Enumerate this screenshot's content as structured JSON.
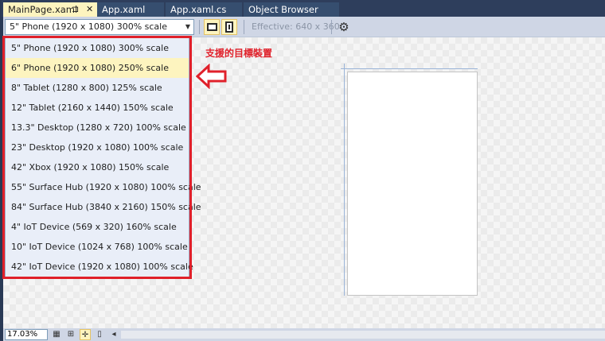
{
  "tabs": [
    {
      "label": "MainPage.xaml",
      "active": true,
      "pin": "⊐",
      "close": "✕"
    },
    {
      "label": "App.xaml",
      "active": false
    },
    {
      "label": "App.xaml.cs",
      "active": false
    },
    {
      "label": "Object Browser",
      "active": false
    }
  ],
  "toolbar": {
    "device_selected": "5\" Phone (1920 x 1080) 300% scale",
    "effective": "Effective: 640 x 360",
    "icons": [
      "landscape-icon",
      "portrait-icon",
      "gear-icon"
    ]
  },
  "device_list": {
    "items": [
      "5\" Phone (1920 x 1080) 300% scale",
      "6\" Phone (1920 x 1080) 250% scale",
      "8\" Tablet (1280 x 800) 125% scale",
      "12\" Tablet (2160 x 1440) 150% scale",
      "13.3\" Desktop (1280 x 720) 100% scale",
      "23\" Desktop (1920 x 1080) 100% scale",
      "42\" Xbox (1920 x 1080) 150% scale",
      "55\" Surface Hub (1920 x 1080) 100% scale",
      "84\" Surface Hub (3840 x 2160) 150% scale",
      "4\" IoT Device (569 x 320) 160% scale",
      "10\" IoT Device (1024 x 768) 100% scale",
      "42\" IoT Device (1920 x 1080) 100% scale"
    ],
    "highlighted_index": 1
  },
  "annotation": {
    "text": "支援的目標裝置",
    "color": "#e0202a"
  },
  "statusbar": {
    "zoom": "17.03%"
  },
  "colors": {
    "frame": "#293955",
    "toolbar": "#cfd6e5",
    "highlight": "#fdf4bf",
    "list_bg": "#e9eef8"
  }
}
